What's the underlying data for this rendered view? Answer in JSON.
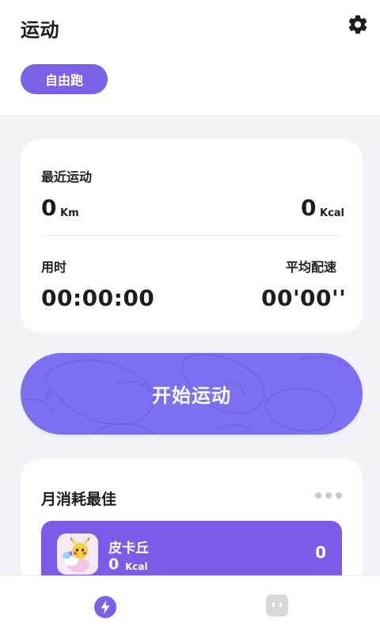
{
  "header": {
    "title": "运动",
    "settings_icon": "gear-icon",
    "mode_pill": "自由跑"
  },
  "recent": {
    "title": "最近运动",
    "distance_value": "0",
    "distance_unit": "Km",
    "calories_value": "0",
    "calories_unit": "Kcal",
    "duration_label": "用时",
    "duration_value": "00:00:00",
    "pace_label": "平均配速",
    "pace_value": "00'00''"
  },
  "start_button": {
    "label": "开始运动"
  },
  "monthly_best": {
    "title": "月消耗最佳",
    "more_icon": "more-dots-icon",
    "entries": [
      {
        "name": "皮卡丘",
        "kcal_value": "0",
        "kcal_unit": "Kcal",
        "score": "0"
      }
    ]
  },
  "tabbar": {
    "tabs": [
      {
        "icon": "lightning-icon",
        "active": true
      },
      {
        "icon": "robot-face-icon",
        "active": false
      }
    ]
  },
  "colors": {
    "accent": "#7B61E6",
    "start_button": "#7B70F2",
    "row_highlight": "#7B5BE8",
    "background": "#F2F3F8"
  }
}
